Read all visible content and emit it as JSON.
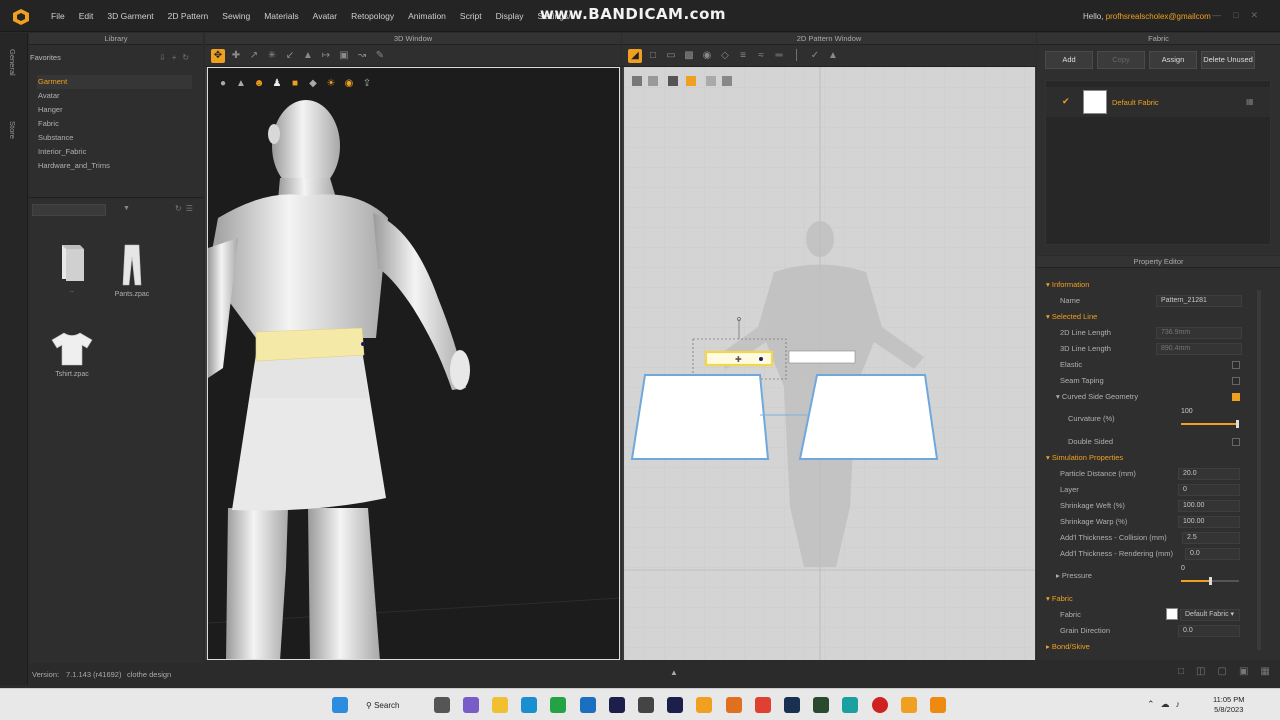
{
  "app": {
    "menu": [
      "File",
      "Edit",
      "3D Garment",
      "2D Pattern",
      "Sewing",
      "Materials",
      "Avatar",
      "Retopology",
      "Animation",
      "Script",
      "Display",
      "Settings/"
    ],
    "watermark": "www.BANDICAM.com",
    "user_greeting": "Hello,",
    "user_email": "profhsrealscholex@gmailcom"
  },
  "side_tabs": [
    "General",
    "Store"
  ],
  "library": {
    "title": "Library",
    "favorites_label": "Favorites",
    "items": [
      "Garment",
      "Avatar",
      "Hanger",
      "Fabric",
      "Substance",
      "Interior_Fabric",
      "Hardware_and_Trims"
    ],
    "active_item": "Garment",
    "files": [
      {
        "label": "..",
        "icon": "folder-up-icon"
      },
      {
        "label": "Pants.zpac",
        "icon": "pants-icon"
      },
      {
        "label": "Tshirt.zpac",
        "icon": "tshirt-icon"
      }
    ]
  },
  "window_3d": {
    "title": "3D Window"
  },
  "window_2d": {
    "title": "2D Pattern Window"
  },
  "fabric_panel": {
    "title": "Fabric",
    "buttons": [
      "Add",
      "Copy",
      "Assign",
      "Delete Unused"
    ],
    "items": [
      {
        "name": "Default Fabric",
        "checked": true
      }
    ]
  },
  "property_editor": {
    "title": "Property Editor",
    "sections": {
      "information": "Information",
      "selected_line": "Selected Line",
      "simulation": "Simulation Properties",
      "fabric": "Fabric",
      "bond": "Bond/Skive"
    },
    "name_label": "Name",
    "name_value": "Pattern_21281",
    "line_2d_label": "2D Line Length",
    "line_2d_value": "736.9mm",
    "line_3d_label": "3D Line Length",
    "line_3d_value": "890.4mm",
    "elastic_label": "Elastic",
    "seam_taping_label": "Seam Taping",
    "curved_label": "Curved Side Geometry",
    "curvature_label": "Curvature (%)",
    "curvature_value": "100",
    "double_sided_label": "Double Sided",
    "particle_label": "Particle Distance (mm)",
    "particle_value": "20.0",
    "layer_label": "Layer",
    "layer_value": "0",
    "weft_label": "Shrinkage Weft (%)",
    "weft_value": "100.00",
    "warp_label": "Shrinkage Warp (%)",
    "warp_value": "100.00",
    "collision_label": "Add'l Thickness - Collision (mm)",
    "collision_value": "2.5",
    "rendering_label": "Add'l Thickness - Rendering (mm)",
    "rendering_value": "0.0",
    "pressure_label": "Pressure",
    "pressure_value": "0",
    "fabric_label": "Fabric",
    "fabric_value": "Default Fabric",
    "grain_label": "Grain Direction",
    "grain_value": "0.0"
  },
  "status": {
    "version_label": "Version:",
    "version_value": "7.1.143 (r41692)",
    "project": "clothe design"
  },
  "taskbar": {
    "search": "Search",
    "time": "11:05 PM",
    "date": "5/8/2023"
  },
  "colors": {
    "accent": "#f0a020",
    "pattern_outline": "#6fa8dc",
    "waistband": "#f4e9a6"
  }
}
